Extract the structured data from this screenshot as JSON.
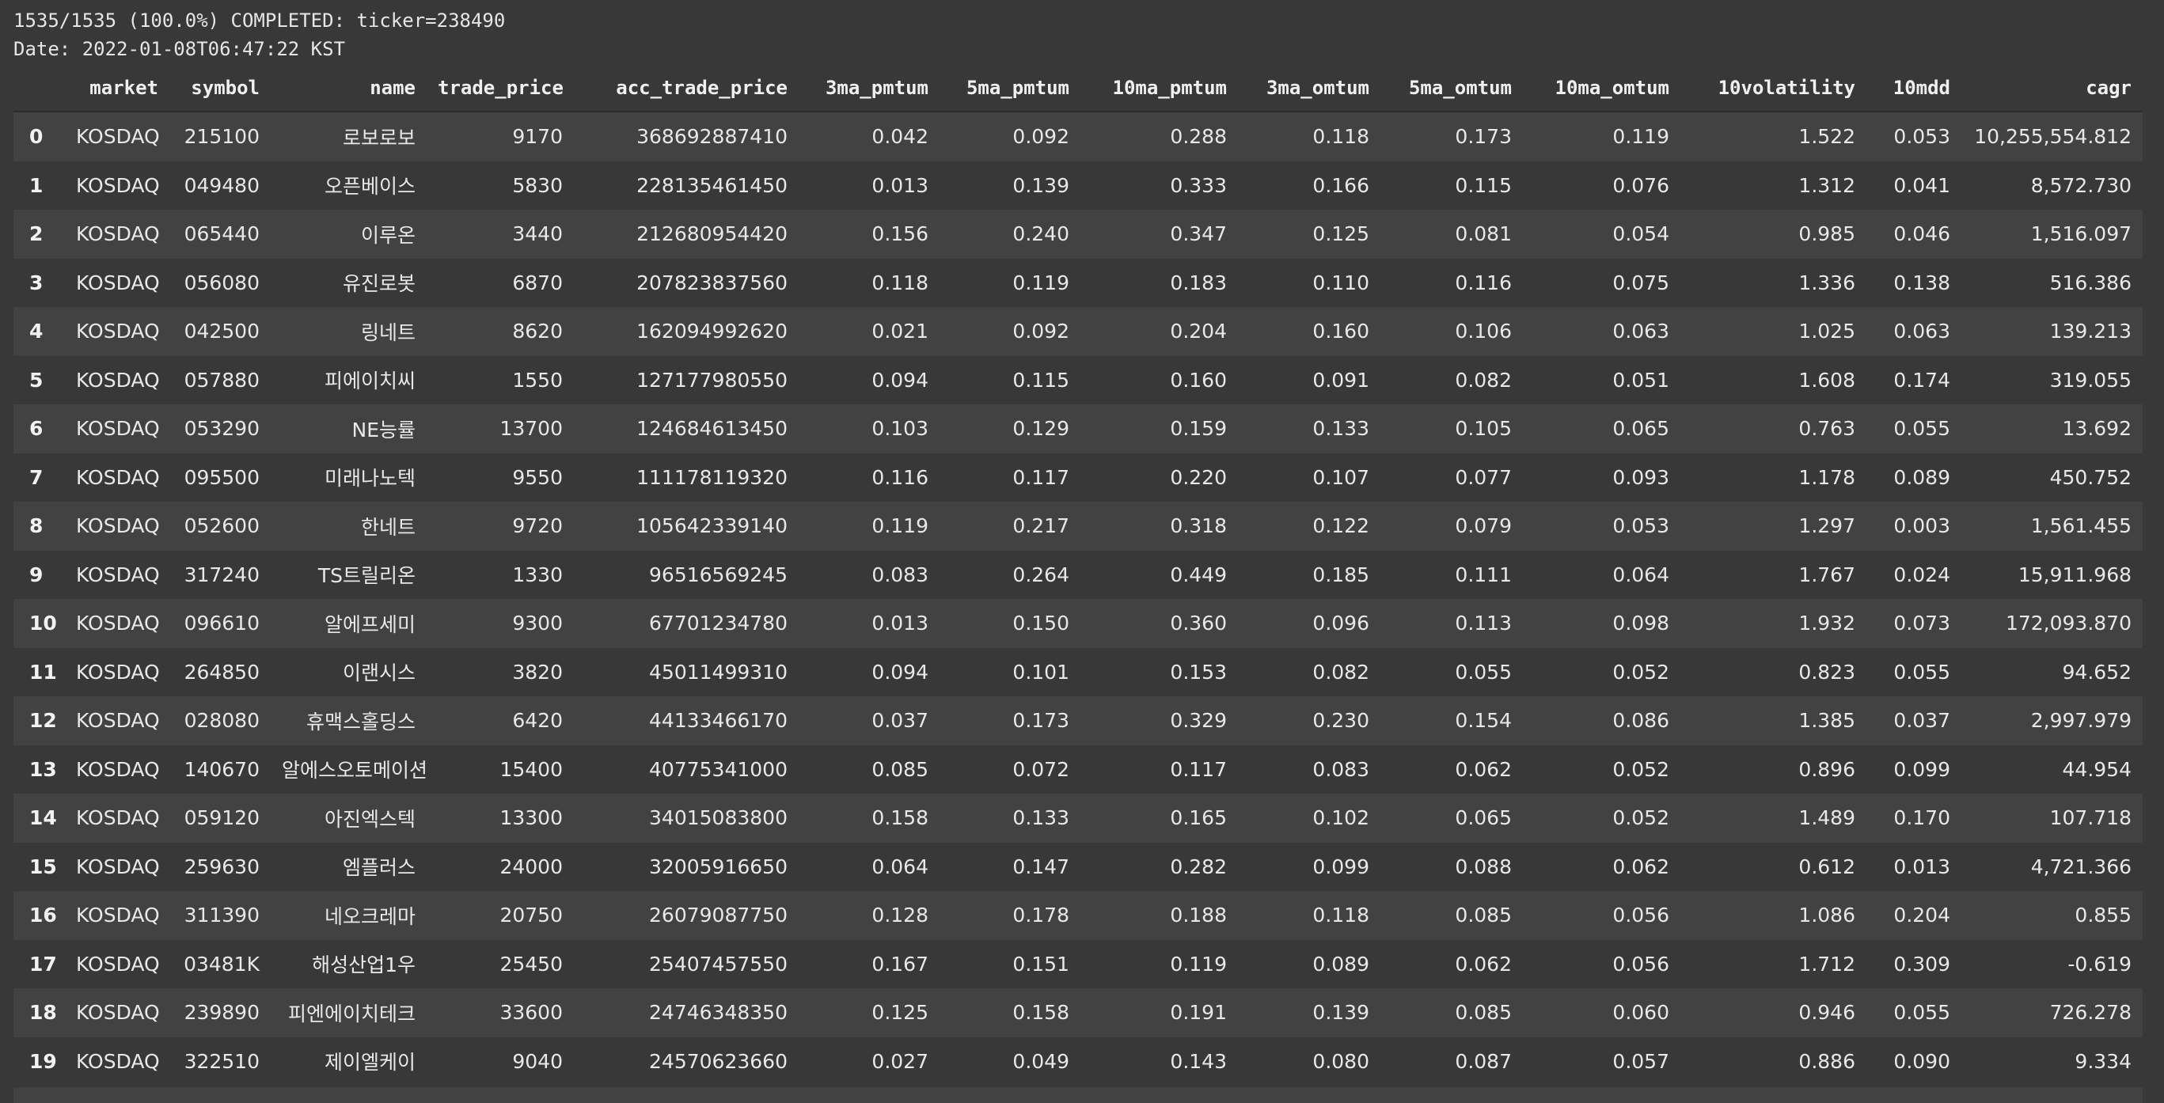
{
  "log": {
    "line1": "1535/1535 (100.0%) COMPLETED: ticker=238490",
    "line2": "Date: 2022-01-08T06:47:22 KST"
  },
  "table": {
    "columns": [
      "",
      "market",
      "symbol",
      "name",
      "trade_price",
      "acc_trade_price",
      "3ma_pmtum",
      "5ma_pmtum",
      "10ma_pmtum",
      "3ma_omtum",
      "5ma_omtum",
      "10ma_omtum",
      "10volatility",
      "10mdd",
      "cagr"
    ],
    "rows": [
      [
        "0",
        "KOSDAQ",
        "215100",
        "로보로보",
        "9170",
        "368692887410",
        "0.042",
        "0.092",
        "0.288",
        "0.118",
        "0.173",
        "0.119",
        "1.522",
        "0.053",
        "10,255,554.812"
      ],
      [
        "1",
        "KOSDAQ",
        "049480",
        "오픈베이스",
        "5830",
        "228135461450",
        "0.013",
        "0.139",
        "0.333",
        "0.166",
        "0.115",
        "0.076",
        "1.312",
        "0.041",
        "8,572.730"
      ],
      [
        "2",
        "KOSDAQ",
        "065440",
        "이루온",
        "3440",
        "212680954420",
        "0.156",
        "0.240",
        "0.347",
        "0.125",
        "0.081",
        "0.054",
        "0.985",
        "0.046",
        "1,516.097"
      ],
      [
        "3",
        "KOSDAQ",
        "056080",
        "유진로봇",
        "6870",
        "207823837560",
        "0.118",
        "0.119",
        "0.183",
        "0.110",
        "0.116",
        "0.075",
        "1.336",
        "0.138",
        "516.386"
      ],
      [
        "4",
        "KOSDAQ",
        "042500",
        "링네트",
        "8620",
        "162094992620",
        "0.021",
        "0.092",
        "0.204",
        "0.160",
        "0.106",
        "0.063",
        "1.025",
        "0.063",
        "139.213"
      ],
      [
        "5",
        "KOSDAQ",
        "057880",
        "피에이치씨",
        "1550",
        "127177980550",
        "0.094",
        "0.115",
        "0.160",
        "0.091",
        "0.082",
        "0.051",
        "1.608",
        "0.174",
        "319.055"
      ],
      [
        "6",
        "KOSDAQ",
        "053290",
        "NE능률",
        "13700",
        "124684613450",
        "0.103",
        "0.129",
        "0.159",
        "0.133",
        "0.105",
        "0.065",
        "0.763",
        "0.055",
        "13.692"
      ],
      [
        "7",
        "KOSDAQ",
        "095500",
        "미래나노텍",
        "9550",
        "111178119320",
        "0.116",
        "0.117",
        "0.220",
        "0.107",
        "0.077",
        "0.093",
        "1.178",
        "0.089",
        "450.752"
      ],
      [
        "8",
        "KOSDAQ",
        "052600",
        "한네트",
        "9720",
        "105642339140",
        "0.119",
        "0.217",
        "0.318",
        "0.122",
        "0.079",
        "0.053",
        "1.297",
        "0.003",
        "1,561.455"
      ],
      [
        "9",
        "KOSDAQ",
        "317240",
        "TS트릴리온",
        "1330",
        "96516569245",
        "0.083",
        "0.264",
        "0.449",
        "0.185",
        "0.111",
        "0.064",
        "1.767",
        "0.024",
        "15,911.968"
      ],
      [
        "10",
        "KOSDAQ",
        "096610",
        "알에프세미",
        "9300",
        "67701234780",
        "0.013",
        "0.150",
        "0.360",
        "0.096",
        "0.113",
        "0.098",
        "1.932",
        "0.073",
        "172,093.870"
      ],
      [
        "11",
        "KOSDAQ",
        "264850",
        "이랜시스",
        "3820",
        "45011499310",
        "0.094",
        "0.101",
        "0.153",
        "0.082",
        "0.055",
        "0.052",
        "0.823",
        "0.055",
        "94.652"
      ],
      [
        "12",
        "KOSDAQ",
        "028080",
        "휴맥스홀딩스",
        "6420",
        "44133466170",
        "0.037",
        "0.173",
        "0.329",
        "0.230",
        "0.154",
        "0.086",
        "1.385",
        "0.037",
        "2,997.979"
      ],
      [
        "13",
        "KOSDAQ",
        "140670",
        "알에스오토메이션",
        "15400",
        "40775341000",
        "0.085",
        "0.072",
        "0.117",
        "0.083",
        "0.062",
        "0.052",
        "0.896",
        "0.099",
        "44.954"
      ],
      [
        "14",
        "KOSDAQ",
        "059120",
        "아진엑스텍",
        "13300",
        "34015083800",
        "0.158",
        "0.133",
        "0.165",
        "0.102",
        "0.065",
        "0.052",
        "1.489",
        "0.170",
        "107.718"
      ],
      [
        "15",
        "KOSDAQ",
        "259630",
        "엠플러스",
        "24000",
        "32005916650",
        "0.064",
        "0.147",
        "0.282",
        "0.099",
        "0.088",
        "0.062",
        "0.612",
        "0.013",
        "4,721.366"
      ],
      [
        "16",
        "KOSDAQ",
        "311390",
        "네오크레마",
        "20750",
        "26079087750",
        "0.128",
        "0.178",
        "0.188",
        "0.118",
        "0.085",
        "0.056",
        "1.086",
        "0.204",
        "0.855"
      ],
      [
        "17",
        "KOSDAQ",
        "03481K",
        "해성산업1우",
        "25450",
        "25407457550",
        "0.167",
        "0.151",
        "0.119",
        "0.089",
        "0.062",
        "0.056",
        "1.712",
        "0.309",
        "-0.619"
      ],
      [
        "18",
        "KOSDAQ",
        "239890",
        "피엔에이치테크",
        "33600",
        "24746348350",
        "0.125",
        "0.158",
        "0.191",
        "0.139",
        "0.085",
        "0.060",
        "0.946",
        "0.055",
        "726.278"
      ],
      [
        "19",
        "KOSDAQ",
        "322510",
        "제이엘케이",
        "9040",
        "24570623660",
        "0.027",
        "0.049",
        "0.143",
        "0.080",
        "0.087",
        "0.057",
        "0.886",
        "0.090",
        "9.334"
      ]
    ]
  }
}
